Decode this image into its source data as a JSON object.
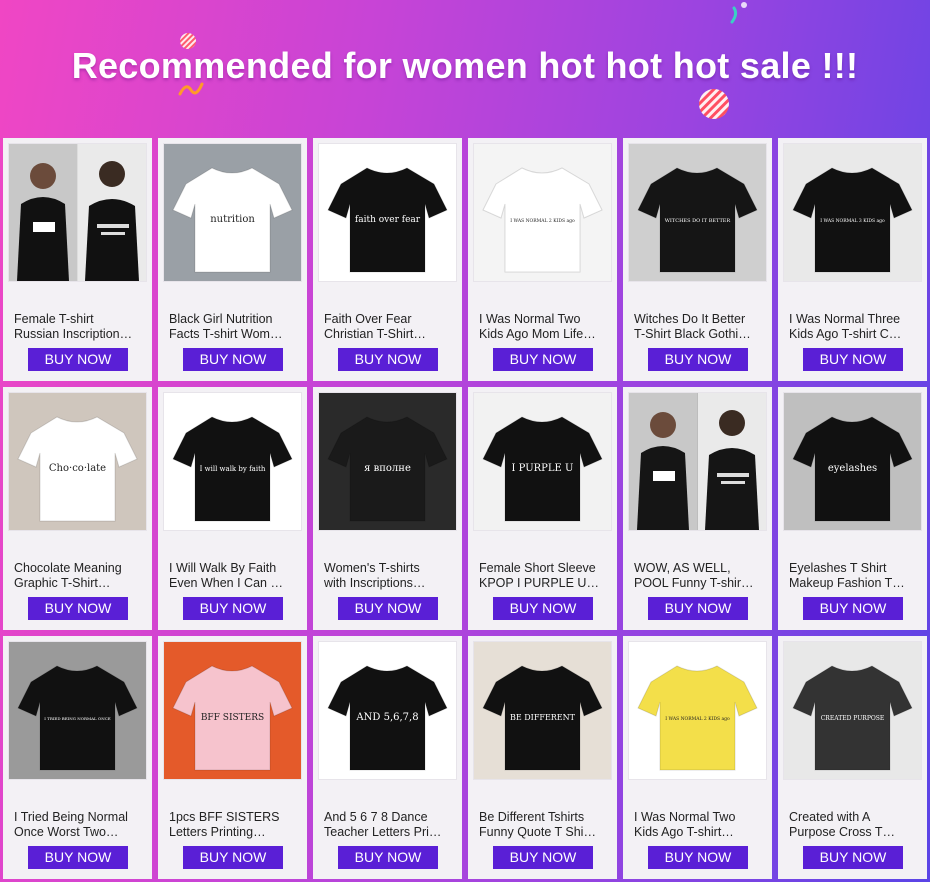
{
  "banner": {
    "title": "Recommended for women hot hot hot sale !!!",
    "colors": {
      "start": "#f046c4",
      "end": "#5a44e6"
    }
  },
  "buy_label": "BUY NOW",
  "colors": {
    "button": "#5a1fd6",
    "card": "#f3f1f5"
  },
  "products": [
    {
      "line1": "Female T-shirt",
      "line2": "Russian Inscription…",
      "shirt": "#111111",
      "bg": "#dddddd",
      "art": "two-photos"
    },
    {
      "line1": "Black Girl Nutrition",
      "line2": "Facts T-shirt Wom…",
      "shirt": "#ffffff",
      "bg": "#9aa0a6",
      "art": "nutrition"
    },
    {
      "line1": "Faith Over Fear",
      "line2": "Christian T-Shirt…",
      "shirt": "#111111",
      "bg": "#ffffff",
      "art": "faith over fear"
    },
    {
      "line1": "I Was Normal Two",
      "line2": "Kids Ago Mom Life…",
      "shirt": "#ffffff",
      "bg": "#f4f4f4",
      "art": "I WAS NORMAL 2 KIDS ago"
    },
    {
      "line1": "Witches Do It Better",
      "line2": "T-Shirt Black Gothi…",
      "shirt": "#151515",
      "bg": "#cfcfcf",
      "art": "WITCHES DO IT BETTER"
    },
    {
      "line1": "I Was Normal Three",
      "line2": "Kids Ago T-shirt C…",
      "shirt": "#111111",
      "bg": "#e9e9e9",
      "art": "I WAS NORMAL 3 KIDS ago"
    },
    {
      "line1": "Chocolate Meaning",
      "line2": "Graphic T-Shirt…",
      "shirt": "#ffffff",
      "bg": "#cfc6bd",
      "art": "Cho·co·late"
    },
    {
      "line1": "I Will Walk By Faith",
      "line2": "Even When I Can …",
      "shirt": "#111111",
      "bg": "#ffffff",
      "art": "I will walk by faith"
    },
    {
      "line1": "Women's T-shirts",
      "line2": "with Inscriptions…",
      "shirt": "#1a1a1a",
      "bg": "#2a2a2a",
      "art": "я вполне"
    },
    {
      "line1": "Female Short Sleeve",
      "line2": "KPOP I PURPLE U…",
      "shirt": "#111111",
      "bg": "#f2f2f2",
      "art": "I PURPLE U"
    },
    {
      "line1": "WOW, AS WELL,",
      "line2": "POOL Funny T-shir…",
      "shirt": "#151515",
      "bg": "#bdbdbd",
      "art": "two-photos"
    },
    {
      "line1": "Eyelashes T Shirt",
      "line2": "Makeup Fashion T…",
      "shirt": "#111111",
      "bg": "#bfbfbf",
      "art": "eyelashes"
    },
    {
      "line1": "I Tried Being Normal",
      "line2": "Once Worst Two…",
      "shirt": "#111111",
      "bg": "#9a9a9a",
      "art": "I TRIED BEING NORMAL ONCE"
    },
    {
      "line1": "1pcs BFF SISTERS",
      "line2": "Letters Printing…",
      "shirt": "#f6c3cd",
      "bg": "#e45a2a",
      "art": "BFF SISTERS"
    },
    {
      "line1": "And 5 6 7 8 Dance",
      "line2": "Teacher Letters Pri…",
      "shirt": "#111111",
      "bg": "#ffffff",
      "art": "AND 5,6,7,8"
    },
    {
      "line1": "Be Different Tshirts",
      "line2": "Funny Quote T Shi…",
      "shirt": "#111111",
      "bg": "#e6dfd6",
      "art": "BE DIFFERENT"
    },
    {
      "line1": "I Was Normal Two",
      "line2": "Kids Ago T-shirt…",
      "shirt": "#f3df4a",
      "bg": "#ffffff",
      "art": "I WAS NORMAL 2 KIDS ago"
    },
    {
      "line1": "Created with A",
      "line2": "Purpose Cross T…",
      "shirt": "#333333",
      "bg": "#e8e8e8",
      "art": "CREATED PURPOSE"
    }
  ]
}
